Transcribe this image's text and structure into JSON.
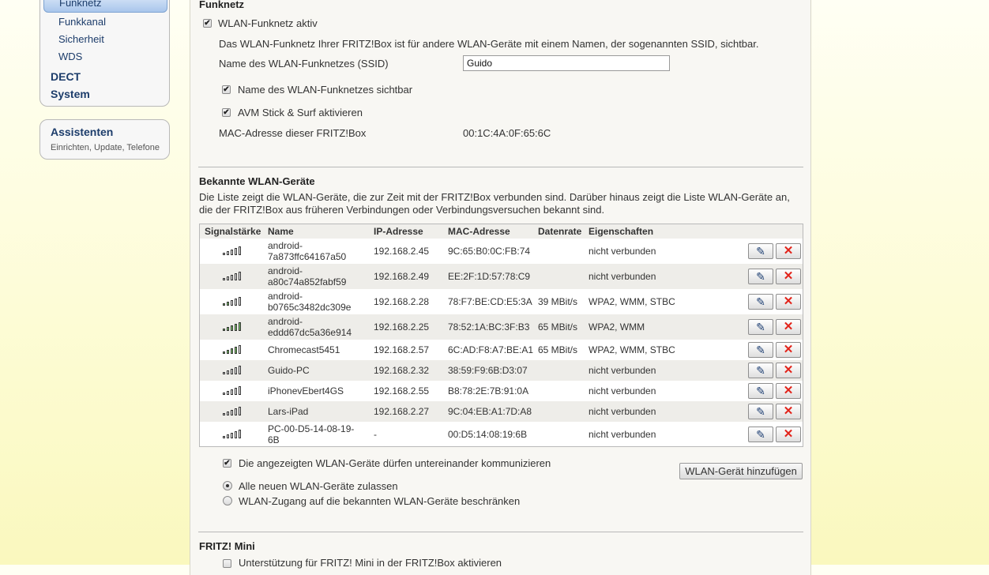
{
  "nav": {
    "active": "Funknetz",
    "sub_items": [
      "Funkkanal",
      "Sicherheit",
      "WDS"
    ],
    "top_items": [
      "DECT",
      "System"
    ]
  },
  "assistant": {
    "title": "Assistenten",
    "subtitle": "Einrichten, Update, Telefone"
  },
  "funknetz": {
    "heading": "Funknetz",
    "active_label": "WLAN-Funknetz aktiv",
    "info": "Das WLAN-Funknetz Ihrer FRITZ!Box ist für andere WLAN-Geräte mit einem Namen, der sogenannten SSID, sichtbar.",
    "ssid_label": "Name des WLAN-Funknetzes (SSID)",
    "ssid_value": "Guido",
    "visible_label": "Name des WLAN-Funknetzes sichtbar",
    "stick_label": "AVM Stick & Surf aktivieren",
    "mac_label": "MAC-Adresse dieser FRITZ!Box",
    "mac_value": "00:1C:4A:0F:65:6C"
  },
  "known": {
    "heading": "Bekannte WLAN-Geräte",
    "desc_line1": "Die Liste zeigt die WLAN-Geräte, die zur Zeit mit der FRITZ!Box verbunden sind. Darüber hinaus zeigt die Liste WLAN-Geräte an,",
    "desc_line2": "die der FRITZ!Box aus früheren Verbindungen oder Verbindungsversuchen bekannt sind.",
    "columns": [
      "Signalstärke",
      "Name",
      "IP-Adresse",
      "MAC-Adresse",
      "Datenrate",
      "Eigenschaften"
    ],
    "devices": [
      {
        "name1": "android-",
        "name2": "7a873ffc64167a50",
        "ip": "192.168.2.45",
        "mac": "9C:65:B0:0C:FB:74",
        "rate": "",
        "props": "nicht verbunden",
        "signal": 0
      },
      {
        "name1": "android-",
        "name2": "a80c74a852fabf59",
        "ip": "192.168.2.49",
        "mac": "EE:2F:1D:57:78:C9",
        "rate": "",
        "props": "nicht verbunden",
        "signal": 0
      },
      {
        "name1": "android-",
        "name2": "b0765c3482dc309e",
        "ip": "192.168.2.28",
        "mac": "78:F7:BE:CD:E5:3A",
        "rate": "39 MBit/s",
        "props": "WPA2, WMM, STBC",
        "signal": 2
      },
      {
        "name1": "android-",
        "name2": "eddd67dc5a36e914",
        "ip": "192.168.2.25",
        "mac": "78:52:1A:BC:3F:B3",
        "rate": "65 MBit/s",
        "props": "WPA2, WMM",
        "signal": 5
      },
      {
        "name1": "Chromecast5451",
        "name2": "",
        "ip": "192.168.2.57",
        "mac": "6C:AD:F8:A7:BE:A1",
        "rate": "65 MBit/s",
        "props": "WPA2, WMM, STBC",
        "signal": 4
      },
      {
        "name1": "Guido-PC",
        "name2": "",
        "ip": "192.168.2.32",
        "mac": "38:59:F9:6B:D3:07",
        "rate": "",
        "props": "nicht verbunden",
        "signal": 0
      },
      {
        "name1": "iPhonevEbert4GS",
        "name2": "",
        "ip": "192.168.2.55",
        "mac": "B8:78:2E:7B:91:0A",
        "rate": "",
        "props": "nicht verbunden",
        "signal": 0
      },
      {
        "name1": "Lars-iPad",
        "name2": "",
        "ip": "192.168.2.27",
        "mac": "9C:04:EB:A1:7D:A8",
        "rate": "",
        "props": "nicht verbunden",
        "signal": 0
      },
      {
        "name1": "PC-00-D5-14-08-19-",
        "name2": "6B",
        "ip": "-",
        "mac": "00:D5:14:08:19:6B",
        "rate": "",
        "props": "nicht verbunden",
        "signal": 0
      }
    ],
    "communicate_label": "Die angezeigten WLAN-Geräte dürfen untereinander kommunizieren",
    "add_button": "WLAN-Gerät hinzufügen",
    "radio_all": "Alle neuen WLAN-Geräte zulassen",
    "radio_known": "WLAN-Zugang auf die bekannten WLAN-Geräte beschränken"
  },
  "mini": {
    "heading": "FRITZ! Mini",
    "support_label": "Unterstützung für FRITZ! Mini in der FRITZ!Box aktivieren"
  },
  "colors": {
    "signal_active": "#7fd36b",
    "nav_text": "#1d3d6b",
    "delete": "#e2231a"
  }
}
